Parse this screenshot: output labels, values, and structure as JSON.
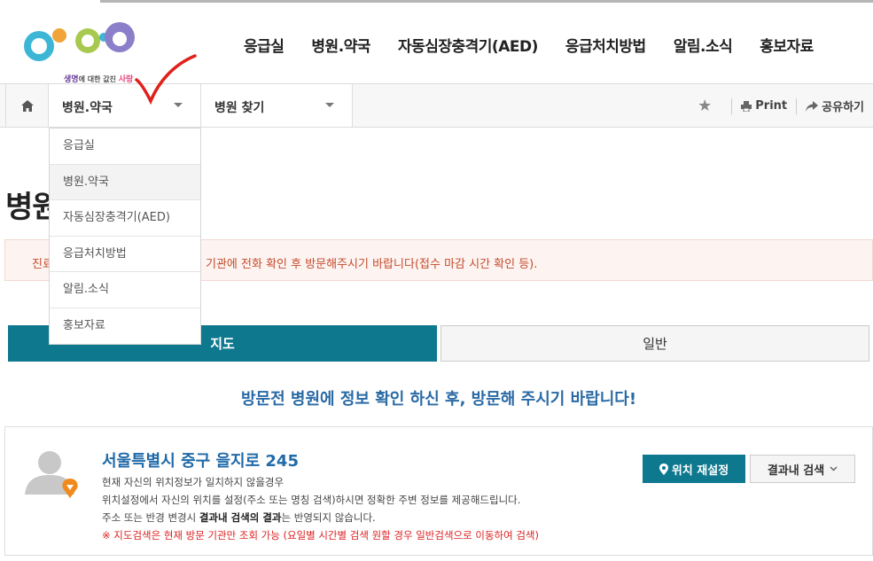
{
  "header": {
    "logo_subtitle_1": "생명",
    "logo_subtitle_2": "에 대한 값진 ",
    "logo_subtitle_3": "사랑",
    "nav": [
      "응급실",
      "병원.약국",
      "자동심장충격기(AED)",
      "응급처치방법",
      "알림.소식",
      "홍보자료"
    ]
  },
  "locbar": {
    "home_icon": "home-icon",
    "dropdown1": "병원.약국",
    "dropdown2": "병원 찾기",
    "print": "Print",
    "share": "공유하기"
  },
  "menu": {
    "items": [
      "응급실",
      "병원.약국",
      "자동심장충격기(AED)",
      "응급처치방법",
      "알림.소식",
      "홍보자료"
    ],
    "active_index": 1
  },
  "page": {
    "title": "병원",
    "notice_lead": "진료",
    "notice": "기관에 전화 확인 후 방문해주시기 바랍니다(접수 마감 시간 확인 등).",
    "tab_map": "지도",
    "tab_general": "일반",
    "visit_message": "방문전 병원에 정보 확인 하신 후, 방문해 주시기 바랍니다!"
  },
  "location": {
    "address": "서울특별시 중구 을지로 245",
    "line1": "현재 자신의 위치정보가 일치하지 않을경우",
    "line2": "위치설정에서 자신의 위치를 설정(주소 또는 명칭 검색)하시면 정확한 주변 정보를 제공해드립니다.",
    "line3_a": "주소 또는 반경 변경시 ",
    "line3_b": "결과내 검색의 결과",
    "line3_c": "는 반영되지 않습니다.",
    "line4": "※ 지도검색은 현재 방문 기관만 조회 가능 (요일별 시간별 검색 원할 경우 일반검색으로 이동하여 검색)",
    "reset_button": "위치 재설정",
    "search_button": "결과내 검색"
  },
  "colors": {
    "teal": "#0e788e",
    "title_blue": "#1f6aa7",
    "notice_red": "#c44b2d",
    "check_red": "#e0201b"
  }
}
